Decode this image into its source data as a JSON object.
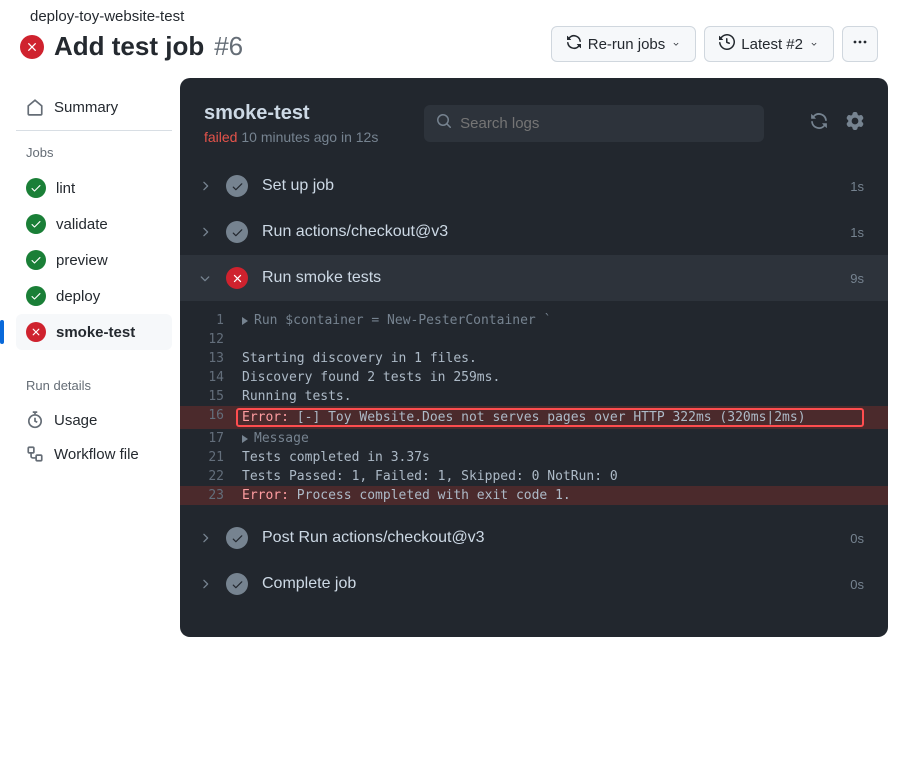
{
  "breadcrumb": {
    "parent": "deploy-toy-website-test"
  },
  "title": {
    "text": "Add test job",
    "number": "#6"
  },
  "header_actions": {
    "rerun": "Re-run jobs",
    "latest": "Latest #2"
  },
  "sidebar": {
    "summary_label": "Summary",
    "jobs_heading": "Jobs",
    "jobs": [
      {
        "label": "lint",
        "status": "success"
      },
      {
        "label": "validate",
        "status": "success"
      },
      {
        "label": "preview",
        "status": "success"
      },
      {
        "label": "deploy",
        "status": "success"
      },
      {
        "label": "smoke-test",
        "status": "error",
        "selected": true
      }
    ],
    "details_heading": "Run details",
    "usage_label": "Usage",
    "workflow_label": "Workflow file"
  },
  "log": {
    "title": "smoke-test",
    "status_word": "failed",
    "status_rest": " 10 minutes ago in 12s",
    "search_placeholder": "Search logs",
    "steps": [
      {
        "label": "Set up job",
        "status": "ok",
        "time": "1s",
        "expanded": false
      },
      {
        "label": "Run actions/checkout@v3",
        "status": "ok",
        "time": "1s",
        "expanded": false
      },
      {
        "label": "Run smoke tests",
        "status": "err",
        "time": "9s",
        "expanded": true
      },
      {
        "label": "Post Run actions/checkout@v3",
        "status": "ok",
        "time": "0s",
        "expanded": false
      },
      {
        "label": "Complete job",
        "status": "ok",
        "time": "0s",
        "expanded": false
      }
    ],
    "lines": [
      {
        "n": "1",
        "caret": true,
        "text": "Run $container = New-PesterContainer `"
      },
      {
        "n": "12",
        "text": ""
      },
      {
        "n": "13",
        "text": "Starting discovery in 1 files."
      },
      {
        "n": "14",
        "text": "Discovery found 2 tests in 259ms."
      },
      {
        "n": "15",
        "text": "Running tests."
      },
      {
        "n": "16",
        "err": true,
        "errPrefix": "Error:",
        "rest": " [-] Toy Website.Does not serves pages over HTTP 322ms (320ms|2ms)",
        "highlight": true
      },
      {
        "n": "17",
        "caret": true,
        "text": "Message"
      },
      {
        "n": "21",
        "text": "Tests completed in 3.37s"
      },
      {
        "n": "22",
        "text": "Tests Passed: 1, Failed: 1, Skipped: 0 NotRun: 0"
      },
      {
        "n": "23",
        "err": true,
        "errPrefix": "Error:",
        "rest": " Process completed with exit code 1."
      }
    ]
  }
}
